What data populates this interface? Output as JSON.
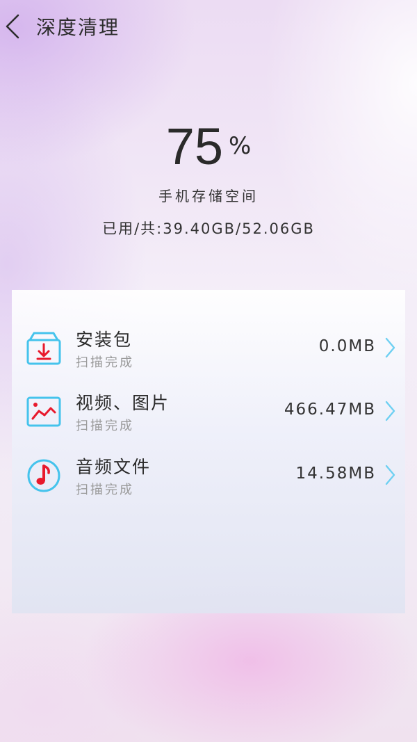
{
  "header": {
    "title": "深度清理",
    "back_icon": "chevron-left-icon"
  },
  "storage": {
    "percent_value": "75",
    "percent_symbol": "%",
    "label": "手机存储空间",
    "usage_text": "已用/共:39.40GB/52.06GB"
  },
  "scan_items": [
    {
      "name": "安装包",
      "status": "扫描完成",
      "size": "0.0MB",
      "icon": "package-download-icon"
    },
    {
      "name": "视频、图片",
      "status": "扫描完成",
      "size": "466.47MB",
      "icon": "image-icon"
    },
    {
      "name": "音频文件",
      "status": "扫描完成",
      "size": "14.58MB",
      "icon": "music-note-icon"
    }
  ],
  "colors": {
    "icon_outline": "#45c3ec",
    "icon_accent": "#e8192c",
    "chevron": "#6ed0f2"
  }
}
